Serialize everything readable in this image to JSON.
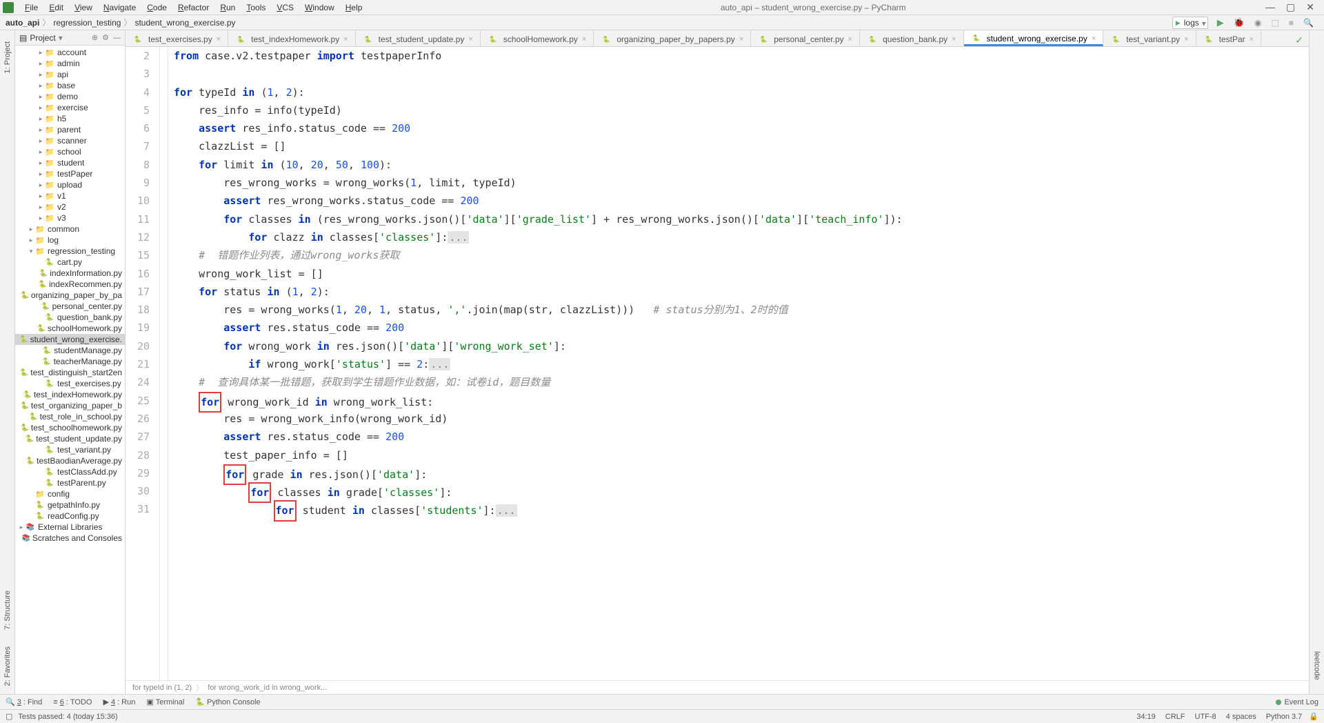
{
  "title": "auto_api – student_wrong_exercise.py – PyCharm",
  "menus": [
    "File",
    "Edit",
    "View",
    "Navigate",
    "Code",
    "Refactor",
    "Run",
    "Tools",
    "VCS",
    "Window",
    "Help"
  ],
  "breadcrumb": [
    "auto_api",
    "regression_testing",
    "student_wrong_exercise.py"
  ],
  "logs_label": "logs",
  "project_header": "Project",
  "tree": [
    {
      "indent": 2,
      "arrow": "closed",
      "icon": "folder",
      "name": "account"
    },
    {
      "indent": 2,
      "arrow": "closed",
      "icon": "folder",
      "name": "admin"
    },
    {
      "indent": 2,
      "arrow": "closed",
      "icon": "folder",
      "name": "api"
    },
    {
      "indent": 2,
      "arrow": "closed",
      "icon": "folder",
      "name": "base"
    },
    {
      "indent": 2,
      "arrow": "closed",
      "icon": "folder",
      "name": "demo"
    },
    {
      "indent": 2,
      "arrow": "closed",
      "icon": "folder",
      "name": "exercise"
    },
    {
      "indent": 2,
      "arrow": "closed",
      "icon": "folder",
      "name": "h5"
    },
    {
      "indent": 2,
      "arrow": "closed",
      "icon": "folder",
      "name": "parent"
    },
    {
      "indent": 2,
      "arrow": "closed",
      "icon": "folder",
      "name": "scanner"
    },
    {
      "indent": 2,
      "arrow": "closed",
      "icon": "folder",
      "name": "school"
    },
    {
      "indent": 2,
      "arrow": "closed",
      "icon": "folder",
      "name": "student"
    },
    {
      "indent": 2,
      "arrow": "closed",
      "icon": "folder",
      "name": "testPaper"
    },
    {
      "indent": 2,
      "arrow": "closed",
      "icon": "folder",
      "name": "upload"
    },
    {
      "indent": 2,
      "arrow": "closed",
      "icon": "folder",
      "name": "v1"
    },
    {
      "indent": 2,
      "arrow": "closed",
      "icon": "folder",
      "name": "v2"
    },
    {
      "indent": 2,
      "arrow": "closed",
      "icon": "folder",
      "name": "v3"
    },
    {
      "indent": 1,
      "arrow": "closed",
      "icon": "folder",
      "name": "common"
    },
    {
      "indent": 1,
      "arrow": "closed",
      "icon": "folder",
      "name": "log"
    },
    {
      "indent": 1,
      "arrow": "open",
      "icon": "folder",
      "name": "regression_testing"
    },
    {
      "indent": 2,
      "arrow": "none",
      "icon": "py",
      "name": "cart.py"
    },
    {
      "indent": 2,
      "arrow": "none",
      "icon": "py",
      "name": "indexInformation.py"
    },
    {
      "indent": 2,
      "arrow": "none",
      "icon": "py",
      "name": "indexRecommen.py"
    },
    {
      "indent": 2,
      "arrow": "none",
      "icon": "py",
      "name": "organizing_paper_by_pa"
    },
    {
      "indent": 2,
      "arrow": "none",
      "icon": "py",
      "name": "personal_center.py"
    },
    {
      "indent": 2,
      "arrow": "none",
      "icon": "py",
      "name": "question_bank.py"
    },
    {
      "indent": 2,
      "arrow": "none",
      "icon": "py",
      "name": "schoolHomework.py"
    },
    {
      "indent": 2,
      "arrow": "none",
      "icon": "py",
      "name": "student_wrong_exercise.",
      "selected": true
    },
    {
      "indent": 2,
      "arrow": "none",
      "icon": "py",
      "name": "studentManage.py"
    },
    {
      "indent": 2,
      "arrow": "none",
      "icon": "py",
      "name": "teacherManage.py"
    },
    {
      "indent": 2,
      "arrow": "none",
      "icon": "py",
      "name": "test_distinguish_start2en"
    },
    {
      "indent": 2,
      "arrow": "none",
      "icon": "py",
      "name": "test_exercises.py"
    },
    {
      "indent": 2,
      "arrow": "none",
      "icon": "py",
      "name": "test_indexHomework.py"
    },
    {
      "indent": 2,
      "arrow": "none",
      "icon": "py",
      "name": "test_organizing_paper_b"
    },
    {
      "indent": 2,
      "arrow": "none",
      "icon": "py",
      "name": "test_role_in_school.py"
    },
    {
      "indent": 2,
      "arrow": "none",
      "icon": "py",
      "name": "test_schoolhomework.py"
    },
    {
      "indent": 2,
      "arrow": "none",
      "icon": "py",
      "name": "test_student_update.py"
    },
    {
      "indent": 2,
      "arrow": "none",
      "icon": "py",
      "name": "test_variant.py"
    },
    {
      "indent": 2,
      "arrow": "none",
      "icon": "py",
      "name": "testBaodianAverage.py"
    },
    {
      "indent": 2,
      "arrow": "none",
      "icon": "py",
      "name": "testClassAdd.py"
    },
    {
      "indent": 2,
      "arrow": "none",
      "icon": "py",
      "name": "testParent.py"
    },
    {
      "indent": 1,
      "arrow": "none",
      "icon": "folder",
      "name": "config"
    },
    {
      "indent": 1,
      "arrow": "none",
      "icon": "py",
      "name": "getpathInfo.py"
    },
    {
      "indent": 1,
      "arrow": "none",
      "icon": "py",
      "name": "readConfig.py"
    },
    {
      "indent": 0,
      "arrow": "closed",
      "icon": "lib",
      "name": "External Libraries"
    },
    {
      "indent": 0,
      "arrow": "none",
      "icon": "lib",
      "name": "Scratches and Consoles"
    }
  ],
  "tabs": [
    {
      "name": "test_exercises.py"
    },
    {
      "name": "test_indexHomework.py"
    },
    {
      "name": "test_student_update.py"
    },
    {
      "name": "schoolHomework.py"
    },
    {
      "name": "organizing_paper_by_papers.py"
    },
    {
      "name": "personal_center.py"
    },
    {
      "name": "question_bank.py"
    },
    {
      "name": "student_wrong_exercise.py",
      "active": true
    },
    {
      "name": "test_variant.py"
    },
    {
      "name": "testPar"
    }
  ],
  "line_numbers": [
    2,
    3,
    4,
    5,
    6,
    7,
    8,
    9,
    10,
    11,
    12,
    15,
    16,
    17,
    18,
    19,
    20,
    21,
    24,
    25,
    26,
    27,
    28,
    29,
    30,
    31
  ],
  "editor_crumb": [
    "for typeId in (1, 2)",
    "for wrong_work_id in wrong_work..."
  ],
  "left_labels": [
    "1: Project",
    "7: Structure",
    "2: Favorites"
  ],
  "right_label": "leetcode",
  "bottom_tools": [
    {
      "key": "3",
      "label": "Find"
    },
    {
      "key": "6",
      "label": "TODO"
    },
    {
      "key": "4",
      "label": "Run"
    },
    {
      "key": "",
      "label": "Terminal"
    },
    {
      "key": "",
      "label": "Python Console"
    }
  ],
  "event_log": "Event Log",
  "status_left": "Tests passed: 4 (today 15:36)",
  "status_items": [
    "34:19",
    "CRLF",
    "UTF-8",
    "4 spaces",
    "Python 3.7"
  ]
}
